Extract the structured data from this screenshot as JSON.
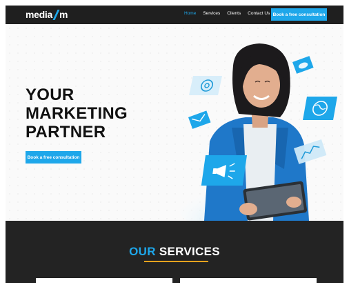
{
  "navbar": {
    "logo_left": "media",
    "logo_right": "m",
    "links": [
      {
        "label": "Home",
        "active": true
      },
      {
        "label": "Services",
        "active": false
      },
      {
        "label": "Clients",
        "active": false
      },
      {
        "label": "Contact Us",
        "active": false
      }
    ],
    "cta_label": "Book a free consultation"
  },
  "hero": {
    "title": "YOUR\nMARKETING\nPARTNER",
    "cta_label": "Book a free consultation",
    "floating_icons": [
      "at-sign-icon",
      "email-icon",
      "globe-icon",
      "megaphone-icon",
      "chart-icon",
      "cloud-icon"
    ]
  },
  "services": {
    "title_accent": "OUR",
    "title_rest": "SERVICES"
  },
  "colors": {
    "accent": "#1ea7ea",
    "underline": "#e6a21e",
    "dark": "#1f1f1f"
  }
}
